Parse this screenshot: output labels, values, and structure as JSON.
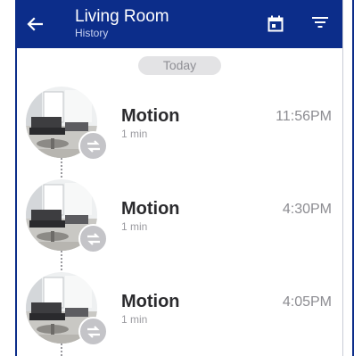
{
  "header": {
    "title": "Living Room",
    "subtitle": "History",
    "back_icon": "arrow-left-icon",
    "calendar_icon": "calendar-icon",
    "filter_icon": "filter-icon"
  },
  "date_group": {
    "label": "Today"
  },
  "events": [
    {
      "title": "Motion",
      "duration": "1 min",
      "time": "11:56PM"
    },
    {
      "title": "Motion",
      "duration": "1 min",
      "time": "4:30PM"
    },
    {
      "title": "Motion",
      "duration": "1 min",
      "time": "4:05PM"
    }
  ],
  "colors": {
    "appbar": "#0c2d8a",
    "pill_bg": "#e3e3e5",
    "badge": "#c4c4c8"
  }
}
